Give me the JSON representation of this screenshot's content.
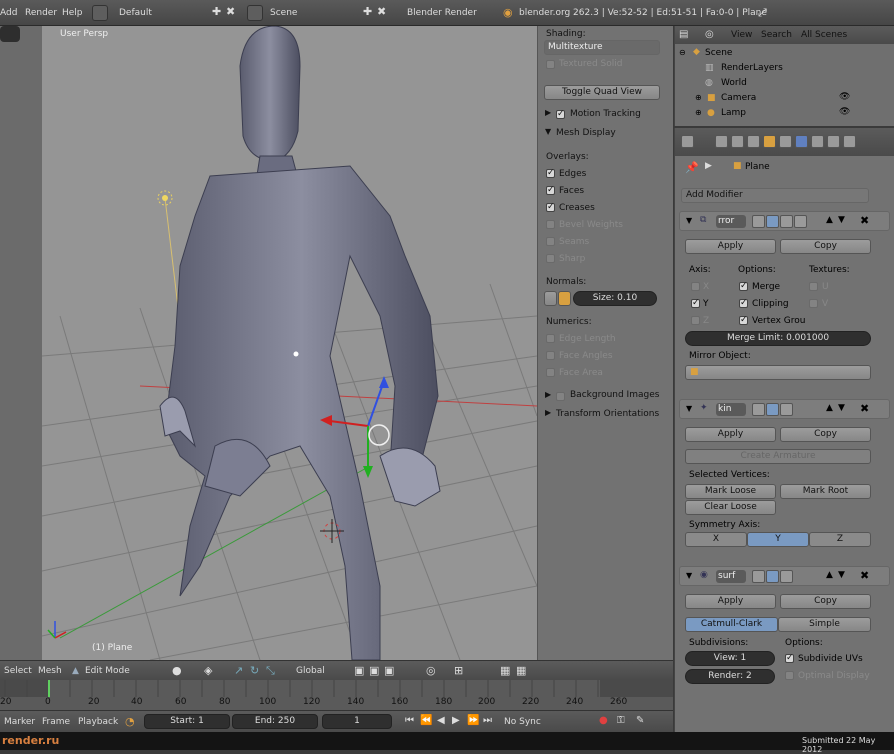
{
  "topbar": {
    "menu_add": "Add",
    "menu_render": "Render",
    "menu_help": "Help",
    "layout": "Default",
    "scene": "Scene",
    "engine": "Blender Render",
    "stats": "blender.org 262.3 | Ve:52-52 | Ed:51-51 | Fa:0-0 | Plane"
  },
  "viewport": {
    "label": "User Persp",
    "object_label": "(1) Plane"
  },
  "npanel": {
    "shading_label": "Shading:",
    "shading_value": "Multitexture",
    "textured_solid": "Textured Solid",
    "toggle_quad": "Toggle Quad View",
    "motion_tracking": "Motion Tracking",
    "mesh_display": "Mesh Display",
    "overlays": "Overlays:",
    "edges": "Edges",
    "faces": "Faces",
    "creases": "Creases",
    "bevel_weights": "Bevel Weights",
    "seams": "Seams",
    "sharp": "Sharp",
    "normals": "Normals:",
    "size": "Size: 0.10",
    "numerics": "Numerics:",
    "edge_length": "Edge Length",
    "face_angles": "Face Angles",
    "face_area": "Face Area",
    "background_images": "Background Images",
    "transform_orientations": "Transform Orientations"
  },
  "outliner": {
    "view": "View",
    "search": "Search",
    "all_scenes": "All Scenes",
    "items": [
      "Scene",
      "RenderLayers",
      "World",
      "Camera",
      "Lamp"
    ]
  },
  "props": {
    "object_name": "Plane",
    "add_modifier": "Add Modifier",
    "mirror": {
      "name": "rror",
      "apply": "Apply",
      "copy": "Copy",
      "axis": "Axis:",
      "options": "Options:",
      "textures": "Textures:",
      "x": "X",
      "y": "Y",
      "z": "Z",
      "merge": "Merge",
      "clipping": "Clipping",
      "vertex_groups": "Vertex Grou",
      "u": "U",
      "v": "V",
      "merge_limit": "Merge Limit: 0.001000",
      "mirror_object": "Mirror Object:"
    },
    "skin": {
      "name": "kin",
      "apply": "Apply",
      "copy": "Copy",
      "create_armature": "Create Armature",
      "selected_vertices": "Selected Vertices:",
      "mark_loose": "Mark Loose",
      "mark_root": "Mark Root",
      "clear_loose": "Clear Loose",
      "symmetry_axis": "Symmetry Axis:",
      "x": "X",
      "y": "Y",
      "z": "Z"
    },
    "subsurf": {
      "name": "surf",
      "apply": "Apply",
      "copy": "Copy",
      "catmull": "Catmull-Clark",
      "simple": "Simple",
      "subdivisions": "Subdivisions:",
      "options": "Options:",
      "view": "View: 1",
      "render": "Render: 2",
      "subdivide_uvs": "Subdivide UVs",
      "optimal_display": "Optimal Display"
    }
  },
  "view_header": {
    "select": "Select",
    "mesh": "Mesh",
    "mode": "Edit Mode",
    "orientation": "Global"
  },
  "timeline": {
    "ticks": [
      "20",
      "0",
      "20",
      "40",
      "60",
      "80",
      "100",
      "120",
      "140",
      "160",
      "180",
      "200",
      "220",
      "240",
      "260"
    ],
    "marker": "Marker",
    "frame": "Frame",
    "playback": "Playback",
    "start": "Start: 1",
    "end": "End: 250",
    "current": "1",
    "sync": "No Sync"
  },
  "footer": {
    "logo": "render.ru",
    "submitted": "Submitted 22 May 2012"
  },
  "colors": {
    "selected_axis": "#7a9ac2",
    "dark_button": "#2f2f2f",
    "panel": "#727272"
  }
}
